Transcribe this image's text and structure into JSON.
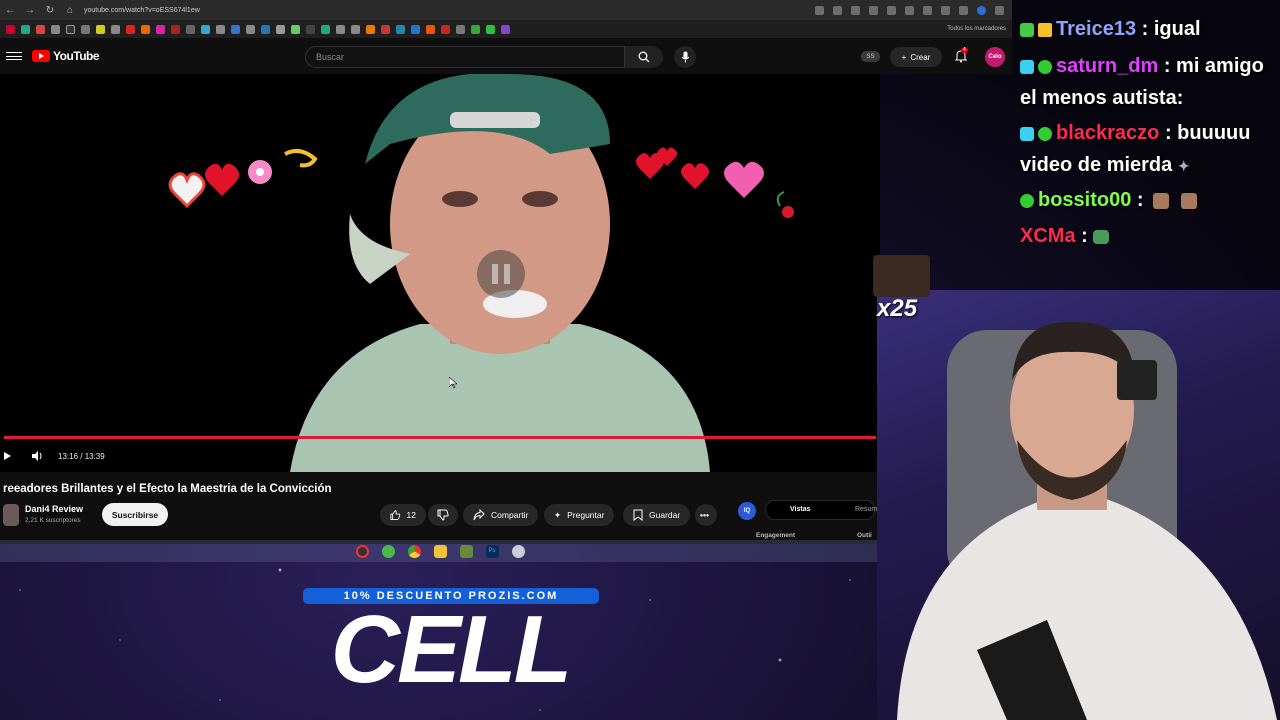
{
  "browser": {
    "url": "youtube.com/watch?v=oESS674l1ew",
    "bookmarks_all": "Todos los marcadores"
  },
  "yt": {
    "logo": "YouTube",
    "search_placeholder": "Buscar",
    "ss_badge": "SS",
    "create_label": "Crear",
    "notif_count": "4",
    "avatar_text": "Celo"
  },
  "video": {
    "timecode": "13:16 / 13:39",
    "progress_fraction": 0.9718
  },
  "meta": {
    "title": "reeadores Brillantes y el Efecto la Maestria de la Convicción",
    "channel_name": "Dani4 Review",
    "channel_subs": "2,21 K suscriptores",
    "subscribe_label": "Suscribirse",
    "likes": "12",
    "share_label": "Compartir",
    "ask_label": "Preguntar",
    "save_label": "Guardar",
    "iq_badge": "IQ",
    "tab_vistas": "Vistas",
    "tab_resumen": "Resum",
    "engagement_label": "Engagement",
    "outline_label": "Outli"
  },
  "overlay": {
    "promo": "10% DESCUENTO PROZIS.COM",
    "cell": "CELL",
    "emote_count": "x25"
  },
  "chat": [
    {
      "user": "Treice13",
      "message": ": igual",
      "color": "#8fa4ff"
    },
    {
      "user": "saturn_dm",
      "message": ": mi amigo",
      "color": "#e040fb"
    },
    {
      "user": "",
      "message": "el menos autista:",
      "color": "#ffffff"
    },
    {
      "user": "blackraczo",
      "message": ": buuuuu",
      "color": "#ff2b4f"
    },
    {
      "user": "",
      "message": "video de mierda",
      "color": "#ffffff"
    },
    {
      "user": "bossito00",
      "message": ":",
      "color": "#7dff4a"
    },
    {
      "user": "XCMa",
      "message": ":",
      "color": "#ff2b4f"
    }
  ]
}
